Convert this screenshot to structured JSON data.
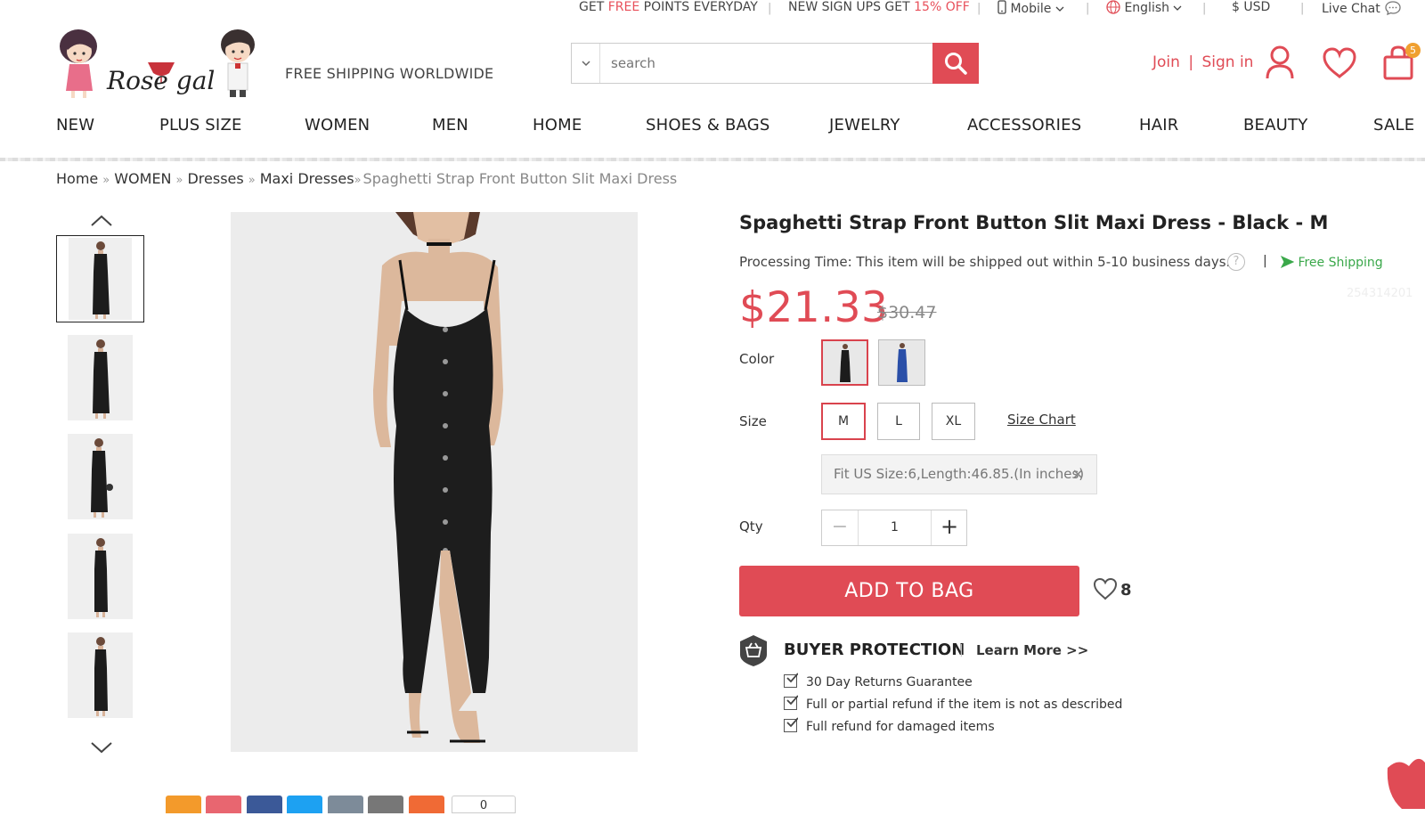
{
  "topbar": {
    "promo1_pre": "GET ",
    "promo1_hl": "FREE",
    "promo1_post": " POINTS EVERYDAY",
    "promo2_pre": "NEW SIGN UPS GET ",
    "promo2_hl": "15% OFF",
    "mobile": "Mobile",
    "language": "English",
    "currency": "$ USD",
    "live_chat": "Live Chat",
    "separator": "|"
  },
  "header": {
    "logo_text": "Rose gal",
    "free_shipping": "FREE SHIPPING WORLDWIDE",
    "search_placeholder": "search",
    "join": "Join",
    "sign_in": "Sign in",
    "account_sep": "|",
    "cart_count": "5"
  },
  "nav": [
    "NEW",
    "PLUS SIZE",
    "WOMEN",
    "MEN",
    "HOME",
    "SHOES & BAGS",
    "JEWELRY",
    "ACCESSORIES",
    "HAIR",
    "BEAUTY",
    "SALE"
  ],
  "breadcrumb": {
    "items": [
      "Home",
      "WOMEN",
      "Dresses",
      "Maxi Dresses"
    ],
    "current": "Spaghetti Strap Front Button Slit Maxi Dress",
    "sep": "»"
  },
  "product": {
    "title": "Spaghetti Strap Front Button Slit Maxi Dress - Black - M",
    "processing": "Processing Time: This item will be shipped out within 5-10 business days.",
    "help": "?",
    "pipe": "|",
    "free_shipping": "Free Shipping",
    "sku": "254314201",
    "price": "$21.33",
    "old_price": "$30.47",
    "color_label": "Color",
    "colors": [
      {
        "name": "Black",
        "hex": "#1c1c1c"
      },
      {
        "name": "Blue",
        "hex": "#2a4fa8"
      }
    ],
    "size_label": "Size",
    "sizes": [
      "M",
      "L",
      "XL"
    ],
    "selected_size": "M",
    "size_chart": "Size Chart",
    "fit_note": "Fit US Size:6,Length:46.85.(In inches)",
    "close": "✕",
    "qty_label": "Qty",
    "qty": "1",
    "minus": "−",
    "plus": "+",
    "add_to_bag": "ADD TO BAG",
    "wish_count": "8",
    "buyer_protection": "BUYER PROTECTION",
    "bp_sep": "|",
    "learn_more": "Learn More >>",
    "guarantees": [
      "30 Day Returns Guarantee",
      "Full or partial refund if the item is not as described",
      "Full refund for damaged items"
    ],
    "share_count": "0"
  },
  "colors": {
    "accent": "#e04b55",
    "free_shipping_green": "#3aa84a",
    "badge": "#f0a030"
  }
}
